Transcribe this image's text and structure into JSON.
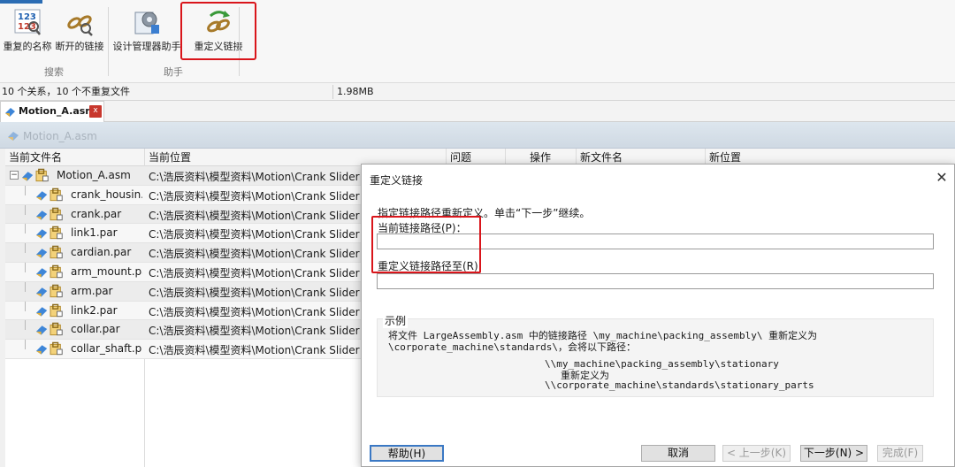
{
  "ribbon": {
    "buttons": [
      {
        "label": "重复的名称",
        "icon": "duplicate-names-icon"
      },
      {
        "label": "断开的链接",
        "icon": "broken-links-icon"
      },
      {
        "label": "设计管理器助手",
        "icon": "design-manager-assistant-icon"
      },
      {
        "label": "重定义链接",
        "icon": "redefine-links-icon"
      }
    ],
    "groups": [
      "搜索",
      "助手"
    ]
  },
  "status": {
    "left": "10 个关系，10 个不重复文件",
    "right": "1.98MB"
  },
  "doc_tab": {
    "label": "Motion_A.asm",
    "close": "x"
  },
  "grey_header_label": "Motion_A.asm",
  "table": {
    "columns": [
      "当前文件名",
      "当前位置",
      "问题",
      "操作",
      "新文件名",
      "新位置"
    ],
    "rows": [
      {
        "name": "Motion_A.asm",
        "location": "C:\\浩辰资料\\模型资料\\Motion\\Crank Slider M"
      },
      {
        "name": "crank_housin...",
        "location": "C:\\浩辰资料\\模型资料\\Motion\\Crank Slider M"
      },
      {
        "name": "crank.par",
        "location": "C:\\浩辰资料\\模型资料\\Motion\\Crank Slider M"
      },
      {
        "name": "link1.par",
        "location": "C:\\浩辰资料\\模型资料\\Motion\\Crank Slider M"
      },
      {
        "name": "cardian.par",
        "location": "C:\\浩辰资料\\模型资料\\Motion\\Crank Slider M"
      },
      {
        "name": "arm_mount.par",
        "location": "C:\\浩辰资料\\模型资料\\Motion\\Crank Slider M"
      },
      {
        "name": "arm.par",
        "location": "C:\\浩辰资料\\模型资料\\Motion\\Crank Slider M"
      },
      {
        "name": "link2.par",
        "location": "C:\\浩辰资料\\模型资料\\Motion\\Crank Slider M"
      },
      {
        "name": "collar.par",
        "location": "C:\\浩辰资料\\模型资料\\Motion\\Crank Slider M"
      },
      {
        "name": "collar_shaft.par",
        "location": "C:\\浩辰资料\\模型资料\\Motion\\Crank Slider M"
      }
    ]
  },
  "dialog": {
    "title": "重定义链接",
    "close": "✕",
    "instruction": "指定链接路径重新定义。单击“下一步”继续。",
    "current_label": "当前链接路径(P)：",
    "current_value": "",
    "redefine_label": "重定义链接路径至(R)",
    "redefine_value": "",
    "example_title": "示例",
    "example_lines": [
      "将文件 LargeAssembly.asm 中的链接路径 \\my_machine\\packing_assembly\\ 重新定义为",
      "\\corporate_machine\\standards\\，会将以下路径：",
      "\\\\my_machine\\packing_assembly\\stationary",
      "重新定义为",
      "\\\\corporate_machine\\standards\\stationary_parts"
    ],
    "buttons": {
      "help": "帮助(H)",
      "cancel": "取消",
      "back": "< 上一步(K)",
      "next": "下一步(N) >",
      "finish": "完成(F)"
    }
  }
}
